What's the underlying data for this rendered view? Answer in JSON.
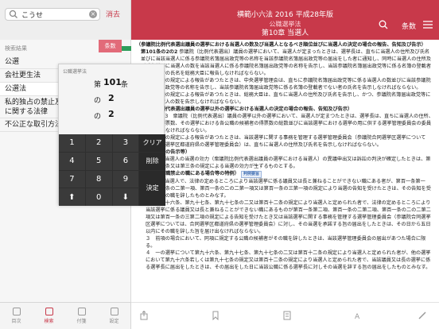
{
  "search": {
    "query": "こうせ",
    "cancel_label": "消去"
  },
  "header": {
    "app_title": "横範小六法 2016 平成28年版",
    "sub_title": "公職選挙法",
    "main_title": "第10章 当選人",
    "article_button": "条数"
  },
  "sidebar": {
    "header": "検索結果",
    "red_tab": "条数",
    "items": [
      {
        "label": "公選"
      },
      {
        "label": "会社更生法"
      },
      {
        "label": "公選法"
      },
      {
        "label": "私的独占の禁止及び公正取引の確保に関する法律"
      },
      {
        "label": "不公正な取引方法"
      }
    ]
  },
  "keypad": {
    "label": "公職選挙法",
    "article_prefix": "第",
    "article_number": "101",
    "article_suffix": "条",
    "no_label_1": "の",
    "branch_1": "2",
    "no_label_2": "の",
    "branch_2": "2",
    "keys": [
      "1",
      "2",
      "3",
      "クリア",
      "4",
      "5",
      "6",
      "削除",
      "7",
      "8",
      "9",
      "決定",
      "⬆",
      "0",
      "⬇"
    ]
  },
  "content": {
    "heading": "（参議院比例代表選出議員の選挙における当選人の数及び当選人となるべき順位並びに当選人の決定の場合の報告、告知及び告示）",
    "article_1": "第101条の2の2",
    "article_1_text": "参議院（比例代表選出）議員の選挙において、当選人が定まったときは、選挙長は、直ちに当選人の住所及び氏名並びに当該当選人に係る参議院名簿届出政党等の名称を当該参議院名簿届出政党等の届出をした者に通知し、同時に当選人の住所及び氏名並びに当選人の数を当該当選人に係る参議院名簿届出政党等の名称を告示し、当該参議院名簿届出政党等に係る名簿の登載者であつた者の氏名を総務大臣に報告しなければならない。",
    "para_2": "２　前項の規定による報告があつたときは、中央選挙管理会は、直ちに参議院名簿届出政党等に係る当選人の数並びに当該参議院名簿届出政党等の名称を告示し、当該参議院名簿届出政党等に係る名簿の登載者でない者の氏名を告示しなければならない。",
    "para_3": "３　前項の規定による報告があつたときは、総務大臣は、直ちに当選人の住所及び氏名を告示し、かつ、参議院名簿届出政党等に係る当選人の数を告示しなければならない。",
    "heading_2": "（参議院比例代表選出議員の選挙以外の選挙における当選人の決定の場合の報告、告知及び告示）",
    "article_2_text": "第101条の3　衆議院（比例代表選出）議員の選挙以外の選挙において、当選人が定まつたときは、選挙長は、直ちに当選人の住所、氏名及び得票数、その選挙における各公職の候補者の得票数の総数並びに当該選挙における選挙の用に供する選挙管理委員会の委員長に報告しなければならない。",
    "para_4": "２　前項の規定による報告があつたときは、当該選挙に関する事務を管理する選挙管理委員会（参議院合同選挙区選挙については、合同選挙区都道府県の選挙管理委員会）は、直ちに当選人の住所及び氏名を告示しなければならない。",
    "heading_3": "（当選人の数の告示等）",
    "article_3_text": "第102条　当選人の当選の効力（衆議院比例代表選出議員の選挙における当選人）の異議申出又は訴訟の判決が確定したときは、第一条、第二条又は第三条の規定による当選の効力が生ずるものとする。",
    "heading_4": "（当選人が兼職禁止の職にある場合等の特例）",
    "badge_label": "判例要旨",
    "article_4_text": "第103条　当選人で、法律の定めるところにより当該選挙に係る議員又は長と兼ねることができない職にある者が、第百一条第一項、第百一条の二第一項、第百一条の二の二第一項又は第百一条の三第一項の規定により当選の告知を受けたときは、その告知を受けた日にその職を辞したものとみなす。",
    "para_5": "２　第九十六条、第九十七条、第九十七条の二又は第百十二条の規定により当選人と定められた者で、法律の定めるところにより当該選挙に係る議員又は長と兼ねることができない職にあるものが第百一条第二項、第百一条の二第二項、第百一条の二の二第二項又は第百一条の三第二項の規定による告知を受けたとき又は当該選挙に関する事務を管理する選挙管理委員会（参議院合同選挙区選挙については、合同選挙区都道府県の選挙管理委員会）に対し、その当選を承諾する旨の届出をしたときは、その日から五日以内にその職を辞した旨を届け出なければならない。",
    "para_6": "３　前項の場合において、同項に規定する公職の候補者がその職を辞したときは、当該選挙管理委員会の届出があつた場合に限る。",
    "para_7": "４　一の選挙について第九十六条、第九十七条、第九十七条の二又は第百十二条の規定により当選人と定められた者が、他の選挙において第九十六条若しくは第九十七条の規定又は第百十二条の規定により当選人と定められた者で、当該議員又は長の選挙に係る選挙長に届出をしたときは、その届出をした日に当該公職に係る選挙長に対しその当選を辞する旨の届出をしたものとみなす。"
  },
  "tabbar": {
    "tabs": [
      {
        "label": "目次"
      },
      {
        "label": "検索"
      },
      {
        "label": "付箋"
      },
      {
        "label": "設定"
      }
    ]
  }
}
